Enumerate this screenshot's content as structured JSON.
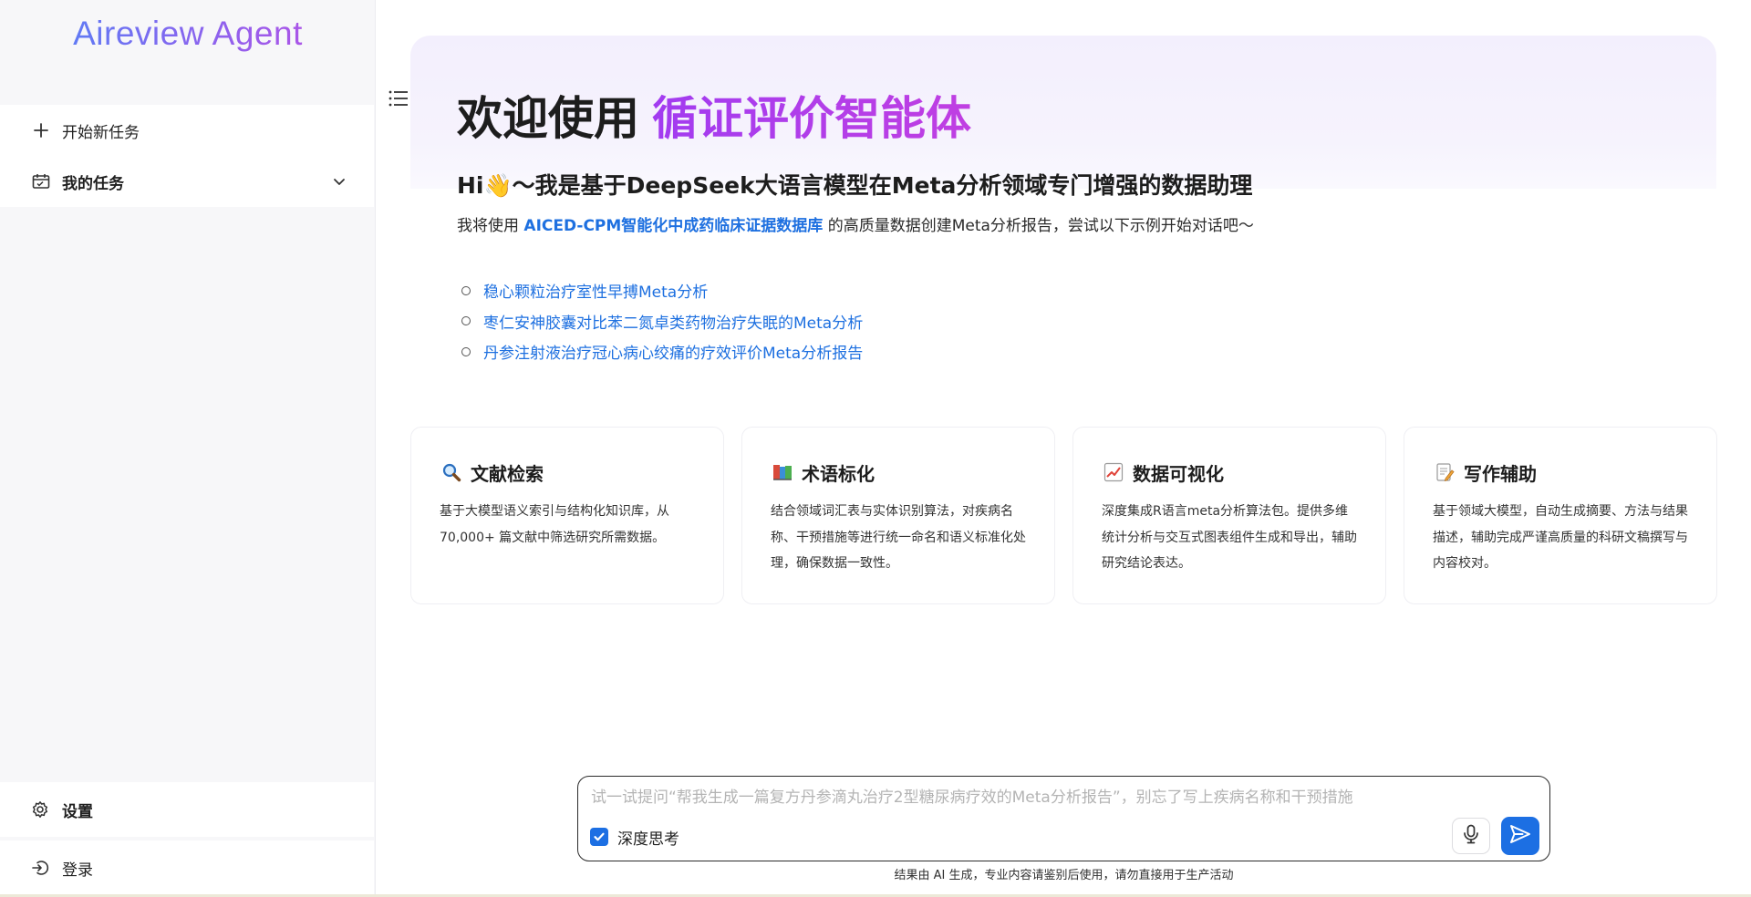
{
  "sidebar": {
    "brand": "Aireview Agent",
    "new_task": {
      "label": "开始新任务",
      "icon": "plus-icon"
    },
    "my_tasks": {
      "label": "我的任务",
      "icon": "task-calendar-icon",
      "expand_icon": "chevron-down-icon"
    },
    "settings": {
      "label": "设置",
      "icon": "gear-icon"
    },
    "login": {
      "label": "登录",
      "icon": "login-icon"
    },
    "toggle_icon": "list-icon"
  },
  "main": {
    "welcome_prefix": "欢迎使用",
    "welcome_accent": "循证评价智能体",
    "hi_prefix": "Hi",
    "hi_emoji": "👋",
    "hi_text": "～我是基于DeepSeek大语言模型在Meta分析领域专门增强的数据助理",
    "intro_before": "我将使用 ",
    "intro_link": "AICED-CPM智能化中成药临床证据数据库",
    "intro_after": " 的高质量数据创建Meta分析报告，尝试以下示例开始对话吧～",
    "examples": [
      "稳心颗粒治疗室性早搏Meta分析",
      "枣仁安神胶囊对比苯二氮卓类药物治疗失眠的Meta分析",
      "丹参注射液治疗冠心病心绞痛的疗效评价Meta分析报告"
    ]
  },
  "cards": [
    {
      "emoji": "🔍",
      "icon": "magnifier-icon",
      "title": "文献检索",
      "desc": "基于大模型语义索引与结构化知识库，从 70,000+ 篇文献中筛选研究所需数据。"
    },
    {
      "emoji": "📚",
      "icon": "books-icon",
      "title": "术语标化",
      "desc": "结合领域词汇表与实体识别算法，对疾病名称、干预措施等进行统一命名和语义标准化处理，确保数据一致性。"
    },
    {
      "emoji": "📈",
      "icon": "chart-increasing-icon",
      "title": "数据可视化",
      "desc": "深度集成R语言meta分析算法包。提供多维统计分析与交互式图表组件生成和导出，辅助研究结论表达。"
    },
    {
      "emoji": "📝",
      "icon": "memo-icon",
      "title": "写作辅助",
      "desc": "基于领域大模型，自动生成摘要、方法与结果描述，辅助完成严谨高质量的科研文稿撰写与内容校对。"
    }
  ],
  "composer": {
    "placeholder": "试一试提问“帮我生成一篇复方丹参滴丸治疗2型糖尿病疗效的Meta分析报告”，别忘了写上疾病名称和干预措施",
    "value": "",
    "deep_think_label": "深度思考",
    "deep_think_checked": true,
    "mic_icon": "microphone-icon",
    "send_icon": "send-icon"
  },
  "disclaimer": "结果由 AI 生成，专业内容请鉴别后使用，请勿直接用于生产活动",
  "colors": {
    "accent_blue": "#1c6fe3",
    "link_blue": "#1e70e0",
    "brand_purple": "#c03fe2",
    "hero_bg": "#f3effd"
  }
}
